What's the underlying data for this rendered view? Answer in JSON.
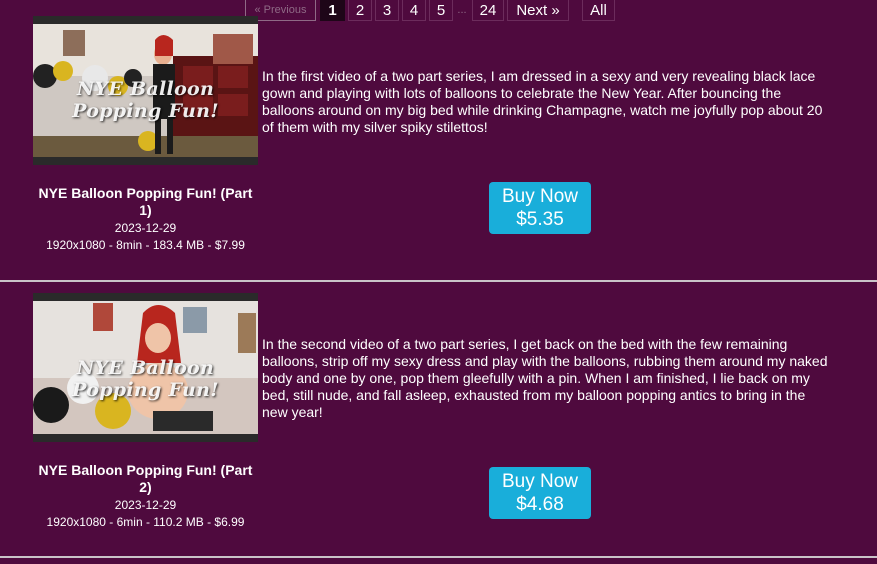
{
  "pagination": {
    "previous": "« Previous",
    "current": "1",
    "pages": [
      "2",
      "3",
      "4",
      "5"
    ],
    "ellipsis": "...",
    "last": "24",
    "next": "Next »",
    "all": "All"
  },
  "items": [
    {
      "thumb_overlay": "NYE Balloon Popping Fun!",
      "title": "NYE Balloon Popping Fun! (Part 1)",
      "date": "2023-12-29",
      "specs": "1920x1080 - 8min - 183.4 MB - $7.99",
      "description": "In the first video of a two part series, I am dressed in a sexy and very revealing black lace gown and playing with lots of balloons to celebrate the New Year. After bouncing the balloons around on my big bed while drinking Champagne, watch me joyfully pop about 20 of them with my silver spiky stilettos!",
      "buy_label": "Buy Now",
      "buy_price": "$5.35"
    },
    {
      "thumb_overlay": "NYE Balloon Popping Fun!",
      "title": "NYE Balloon Popping Fun! (Part 2)",
      "date": "2023-12-29",
      "specs": "1920x1080 - 6min - 110.2 MB - $6.99",
      "description": "In the second video of a two part series, I get back on the bed with the few remaining balloons, strip off my sexy dress and play with the balloons, rubbing them around my naked body and one by one, pop them gleefully with a pin. When I am finished, I lie back on my bed, still nude, and fall asleep, exhausted from my balloon popping antics to bring in the new year!",
      "buy_label": "Buy Now",
      "buy_price": "$4.68"
    }
  ]
}
